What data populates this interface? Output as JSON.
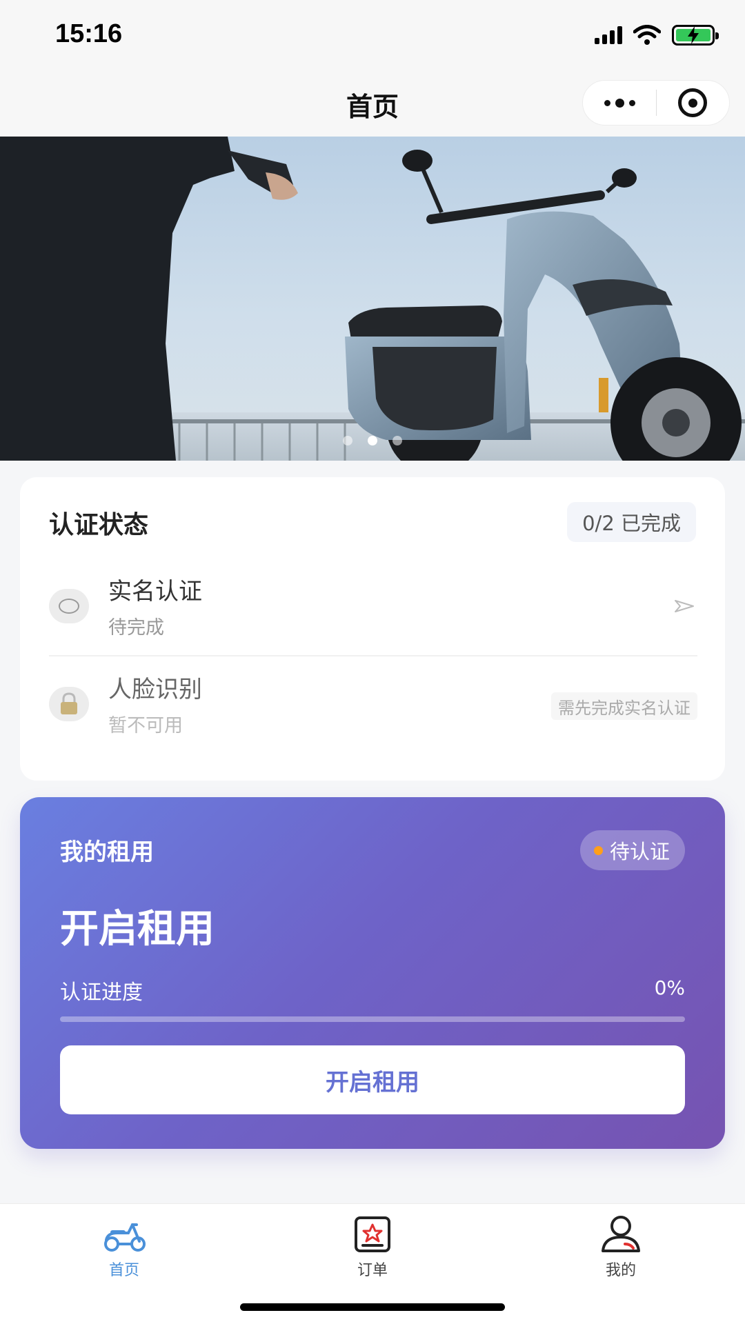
{
  "status_bar": {
    "time": "15:16"
  },
  "nav": {
    "title": "首页"
  },
  "banner": {
    "slide_count": 3,
    "active_index": 1
  },
  "cert": {
    "title": "认证状态",
    "badge": "0/2 已完成",
    "items": [
      {
        "label": "实名认证",
        "status": "待完成"
      },
      {
        "label": "人脸识别",
        "status": "暂不可用",
        "tag": "需先完成实名认证"
      }
    ]
  },
  "rental": {
    "title": "我的租用",
    "status": "待认证",
    "headline": "开启租用",
    "progress_label": "认证进度",
    "progress_value": "0%",
    "progress_fraction": 0,
    "button_label": "开启租用"
  },
  "tabbar": {
    "items": [
      {
        "label": "首页",
        "icon": "scooter-icon",
        "active": true
      },
      {
        "label": "订单",
        "icon": "order-icon",
        "active": false
      },
      {
        "label": "我的",
        "icon": "user-icon",
        "active": false
      }
    ]
  },
  "colors": {
    "accent": "#6571d3",
    "card_gradient_start": "#6a7fe0",
    "card_gradient_end": "#7653b1",
    "status_dot": "#ff9f1a",
    "tab_active": "#4a90d9"
  }
}
